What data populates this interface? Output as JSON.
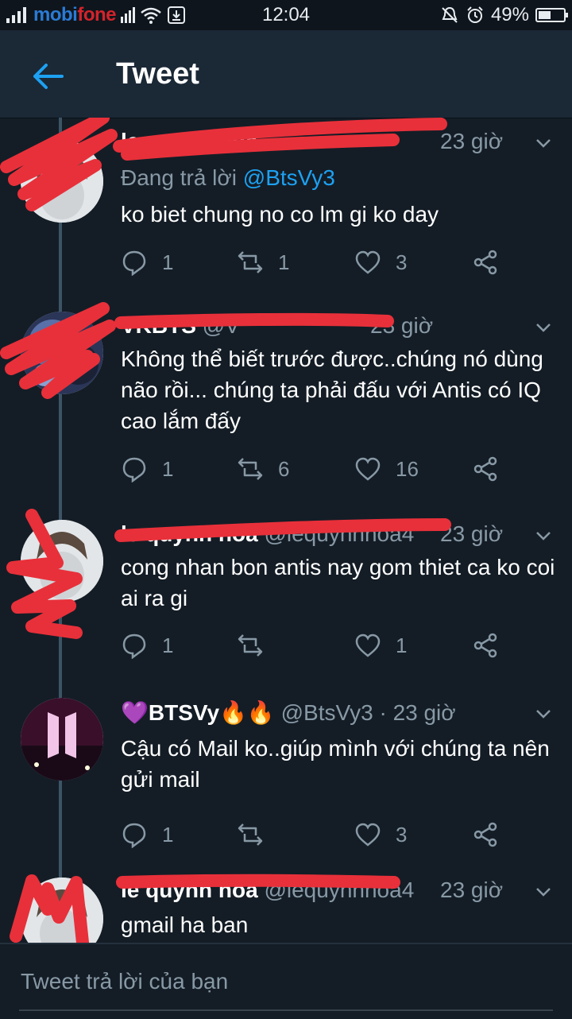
{
  "status_bar": {
    "carrier_m": "mobi",
    "carrier_f": "fone",
    "time": "12:04",
    "battery": "49%",
    "battery_level": 0.49
  },
  "header": {
    "title": "Tweet"
  },
  "tweets": [
    {
      "name": "le quynh hoa",
      "handle": "",
      "time": "23 giờ",
      "reply_prefix": "Đang trả lời ",
      "reply_to": "@BtsVy3",
      "text": "ko biet chung no co lm gi ko day",
      "replies": "1",
      "retweets": "1",
      "likes": "3"
    },
    {
      "name": "VKBTS",
      "handle": "@V",
      "time": "23 giờ",
      "text": "Không thể biết trước được..chúng nó dùng não rồi... chúng ta phải đấu với Antis có IQ cao lắm đấy",
      "replies": "1",
      "retweets": "6",
      "likes": "16"
    },
    {
      "name": "le quynh hoa",
      "handle": "@lequynhhoa4",
      "time": "23 giờ",
      "text": "cong nhan bon antis nay gom thiet ca ko coi ai ra gi",
      "replies": "1",
      "retweets": "",
      "likes": "1"
    },
    {
      "name": "💜BTSVy🔥🔥",
      "handle": "@BtsVy3 · 23 giờ",
      "time": "",
      "text": "Cậu có Mail ko..giúp mình với chúng ta nên gửi mail",
      "replies": "1",
      "retweets": "",
      "likes": "3"
    },
    {
      "name": "le quynh hoa",
      "handle": "@lequynhhoa4",
      "time": "23 giờ",
      "text": "gmail ha ban"
    }
  ],
  "reply_bar": {
    "placeholder": "Tweet trả lời của bạn"
  },
  "colors": {
    "background": "#141d26",
    "header": "#1b2836",
    "accent": "#1da1f2",
    "muted": "#8899a6",
    "redaction": "#e8303a"
  },
  "icons": [
    "signal-icon",
    "wifi-icon",
    "alarm-off-icon",
    "alarm-icon",
    "back-arrow-icon",
    "reply-icon",
    "retweet-icon",
    "like-icon",
    "share-icon",
    "caret-down-icon"
  ]
}
